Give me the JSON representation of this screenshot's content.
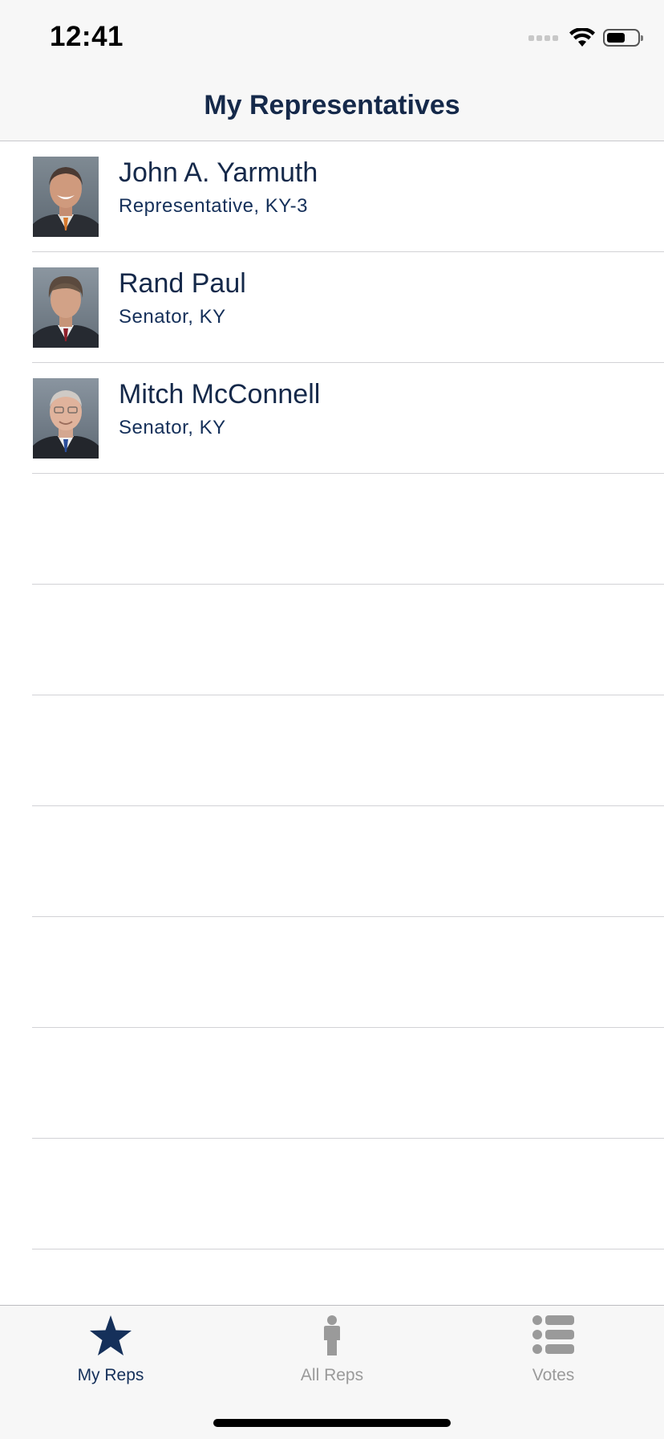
{
  "status_bar": {
    "time": "12:41",
    "icons": [
      "cellular-signal-icon",
      "wifi-icon",
      "battery-icon"
    ]
  },
  "nav": {
    "title": "My Representatives"
  },
  "representatives": [
    {
      "name": "John A. Yarmuth",
      "role": "Representative, KY-3",
      "photo": "portrait-photo"
    },
    {
      "name": "Rand Paul",
      "role": "Senator, KY",
      "photo": "portrait-photo"
    },
    {
      "name": "Mitch McConnell",
      "role": "Senator, KY",
      "photo": "portrait-photo"
    }
  ],
  "tab_bar": {
    "items": [
      {
        "label": "My Reps",
        "icon": "star-icon",
        "selected": true
      },
      {
        "label": "All Reps",
        "icon": "person-icon",
        "selected": false
      },
      {
        "label": "Votes",
        "icon": "list-icon",
        "selected": false
      }
    ]
  },
  "colors": {
    "text_primary": "#15294a",
    "tab_active": "#15305a",
    "tab_inactive": "#9a9a9a",
    "bar_background": "#f7f7f7",
    "separator": "#d2d2d6"
  }
}
